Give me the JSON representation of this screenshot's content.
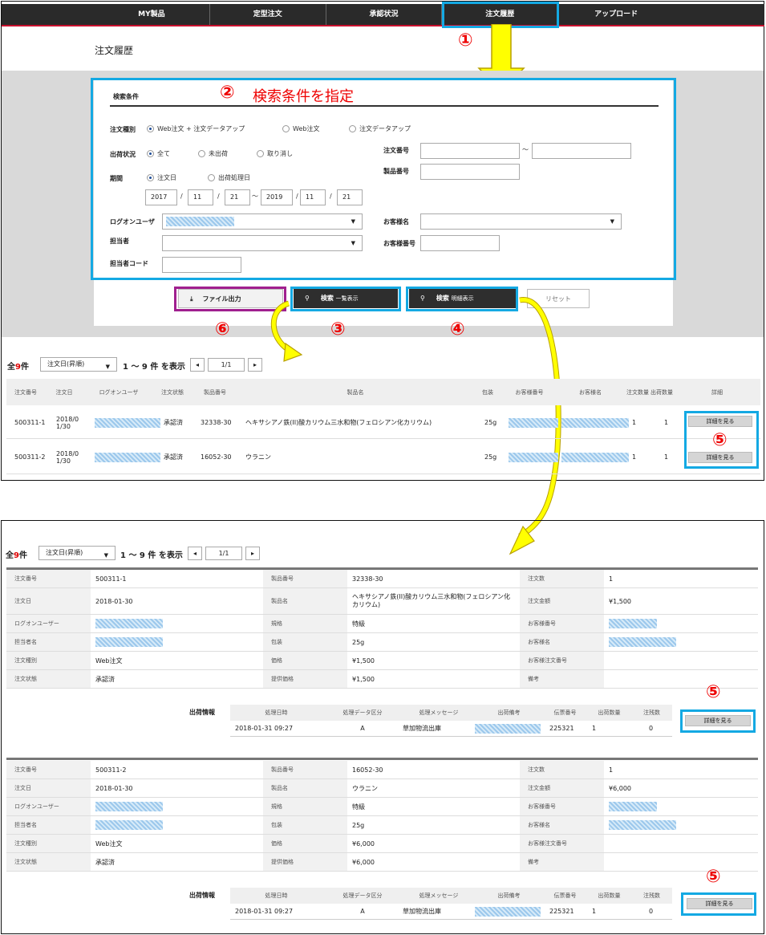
{
  "nav": {
    "items": [
      "MY製品",
      "定型注文",
      "承認状況",
      "注文履歴",
      "アップロード"
    ]
  },
  "page": {
    "title": "注文履歴"
  },
  "search": {
    "heading": "検索条件",
    "annotation": "検索条件を指定",
    "order_type_label": "注文種別",
    "order_type_options": [
      "Web注文 + 注文データアップ",
      "Web注文",
      "注文データアップ"
    ],
    "ship_status_label": "出荷状況",
    "ship_status_options": [
      "全て",
      "未出荷",
      "取り消し"
    ],
    "period_label": "期間",
    "period_options": [
      "注文日",
      "出荷処理日"
    ],
    "date_from": {
      "y": "2017",
      "m": "11",
      "d": "21"
    },
    "date_to": {
      "y": "2019",
      "m": "11",
      "d": "21"
    },
    "sep_slash": "/",
    "sep_tilde": "〜",
    "logon_user_label": "ログオンユーザ",
    "staff_label": "担当者",
    "staff_code_label": "担当者コード",
    "order_no_label": "注文番号",
    "product_no_label": "製品番号",
    "customer_name_label": "お客様名",
    "customer_no_label": "お客様番号"
  },
  "buttons": {
    "file_output": "ファイル出力",
    "search_list": "検索",
    "search_list_sub": "一覧表示",
    "search_detail": "検索",
    "search_detail_sub": "明細表示",
    "reset": "リセット"
  },
  "markers": [
    "①",
    "②",
    "③",
    "④",
    "⑤",
    "⑥"
  ],
  "pager": {
    "total_prefix": "全",
    "total_count": "9",
    "total_suffix": "件",
    "sort": "注文日(昇順)",
    "range": "1 〜 9 件 を表示",
    "page": "1/1",
    "prev": "◂",
    "next": "▸"
  },
  "list": {
    "headers": [
      "注文番号",
      "注文日",
      "ログオンユーザ",
      "注文状態",
      "製品番号",
      "製品名",
      "包装",
      "お客様番号",
      "お客様名",
      "注文数量",
      "出荷数量",
      "詳細"
    ],
    "rows": [
      {
        "order_no": "500311-1",
        "date": "2018/0 1/30",
        "status": "承認済",
        "product_no": "32338-30",
        "product_name": "ヘキサシアノ鉄(II)酸カリウム三水和物(フェロシアン化カリウム)",
        "pack": "25g",
        "qty": "1",
        "ship_qty": "1",
        "detail": "詳細を見る"
      },
      {
        "order_no": "500311-2",
        "date": "2018/0 1/30",
        "status": "承認済",
        "product_no": "16052-30",
        "product_name": "ウラニン",
        "pack": "25g",
        "qty": "1",
        "ship_qty": "1",
        "detail": "詳細を見る"
      }
    ]
  },
  "detail": {
    "keys_col1": [
      "注文番号",
      "注文日",
      "ログオンユーザー",
      "担当者名",
      "注文種別",
      "注文状態"
    ],
    "keys_col2": [
      "製品番号",
      "製品名",
      "規格",
      "包装",
      "価格",
      "提供価格"
    ],
    "keys_col3": [
      "注文数",
      "注文金額",
      "お客様番号",
      "お客様名",
      "お客様注文番号",
      "備考"
    ],
    "ship_label": "出荷情報",
    "ship_headers": [
      "処理日時",
      "処理データ区分",
      "処理メッセージ",
      "出荷備考",
      "伝票番号",
      "出荷数量",
      "注残数"
    ],
    "detail_btn": "詳細を見る",
    "records": [
      {
        "order_no": "500311-1",
        "date": "2018-01-30",
        "order_type": "Web注文",
        "status": "承認済",
        "product_no": "32338-30",
        "product_name": "ヘキサシアノ鉄(II)酸カリウム三水和物(フェロシアン化カリウム)",
        "grade": "特級",
        "pack": "25g",
        "price": "¥1,500",
        "offer_price": "¥1,500",
        "qty": "1",
        "amount": "¥1,500",
        "ship": {
          "datetime": "2018-01-31 09:27",
          "kubun": "A",
          "message": "草加物流出庫",
          "slip": "225321",
          "ship_qty": "1",
          "remain": "0"
        }
      },
      {
        "order_no": "500311-2",
        "date": "2018-01-30",
        "order_type": "Web注文",
        "status": "承認済",
        "product_no": "16052-30",
        "product_name": "ウラニン",
        "grade": "特級",
        "pack": "25g",
        "price": "¥6,000",
        "offer_price": "¥6,000",
        "qty": "1",
        "amount": "¥6,000",
        "ship": {
          "datetime": "2018-01-31 09:27",
          "kubun": "A",
          "message": "草加物流出庫",
          "slip": "225321",
          "ship_qty": "1",
          "remain": "0"
        }
      }
    ]
  }
}
